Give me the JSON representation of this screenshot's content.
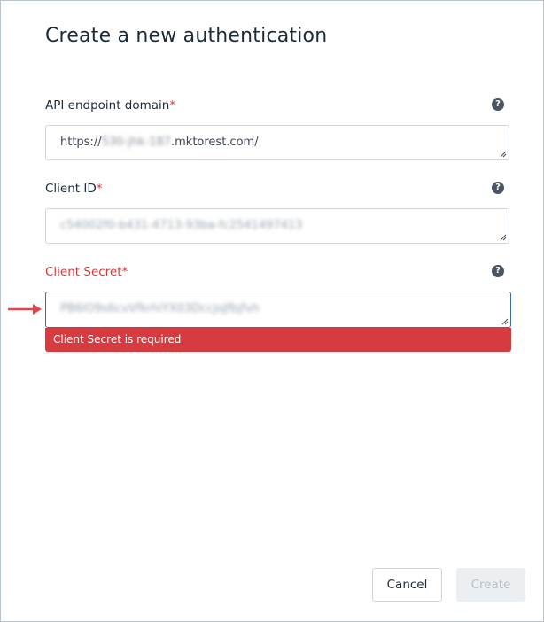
{
  "dialog": {
    "title": "Create a new authentication"
  },
  "fields": {
    "api_endpoint": {
      "label": "API endpoint domain",
      "required_mark": "*",
      "value_prefix": "https://",
      "value_redacted": "530-jhk-187",
      "value_suffix": ".mktorest.com/"
    },
    "client_id": {
      "label": "Client ID",
      "required_mark": "*",
      "value": "c54002f0-b431-4713-93ba-fc2541497413"
    },
    "client_secret": {
      "label": "Client Secret",
      "required_mark": "*",
      "value": "PB6lO9s6cvVfkrhiYX03DccjoJfbjfvh",
      "error": "Client Secret is required"
    }
  },
  "help_icon_glyph": "?",
  "buttons": {
    "cancel": "Cancel",
    "create": "Create"
  },
  "colors": {
    "error": "#d63c3f",
    "annotation_arrow": "#e0454b",
    "active_border": "#3a6ea5"
  },
  "icons": {
    "help": "question-circle-icon",
    "resize": "resize-grip-icon",
    "annotation": "arrow-right-icon"
  }
}
